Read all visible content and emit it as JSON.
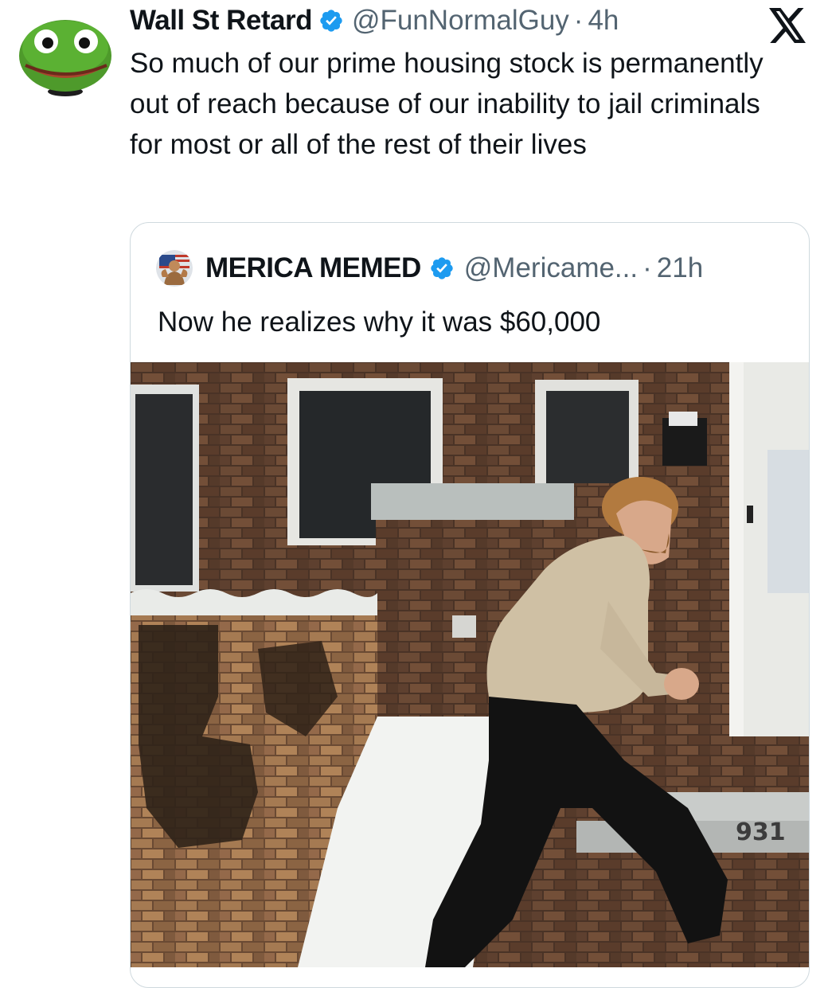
{
  "tweet": {
    "author_name": "Wall St Retard",
    "handle": "@FunNormalGuy",
    "separator": "·",
    "time": "4h",
    "text": "So much of our prime housing stock is permanently out of reach because of our inability to jail criminals for most or all of the rest of their lives",
    "avatar_icon": "pepe-frog-avatar-icon",
    "verified_icon": "verified-badge-icon",
    "platform_icon": "x-logo-icon"
  },
  "quote": {
    "author_name": "MERICA MEMED",
    "handle": "@Mericame...",
    "separator": "·",
    "time": "21h",
    "text": "Now he realizes why it was $60,000",
    "avatar_icon": "patriot-avatar-icon",
    "verified_icon": "verified-badge-icon",
    "media_icon": "video-still-man-brick-porch",
    "media_overlay_text": "931"
  },
  "colors": {
    "verified_blue": "#1d9bf0",
    "text": "#0f1419",
    "secondary": "#536471",
    "border": "#cfd9de"
  }
}
